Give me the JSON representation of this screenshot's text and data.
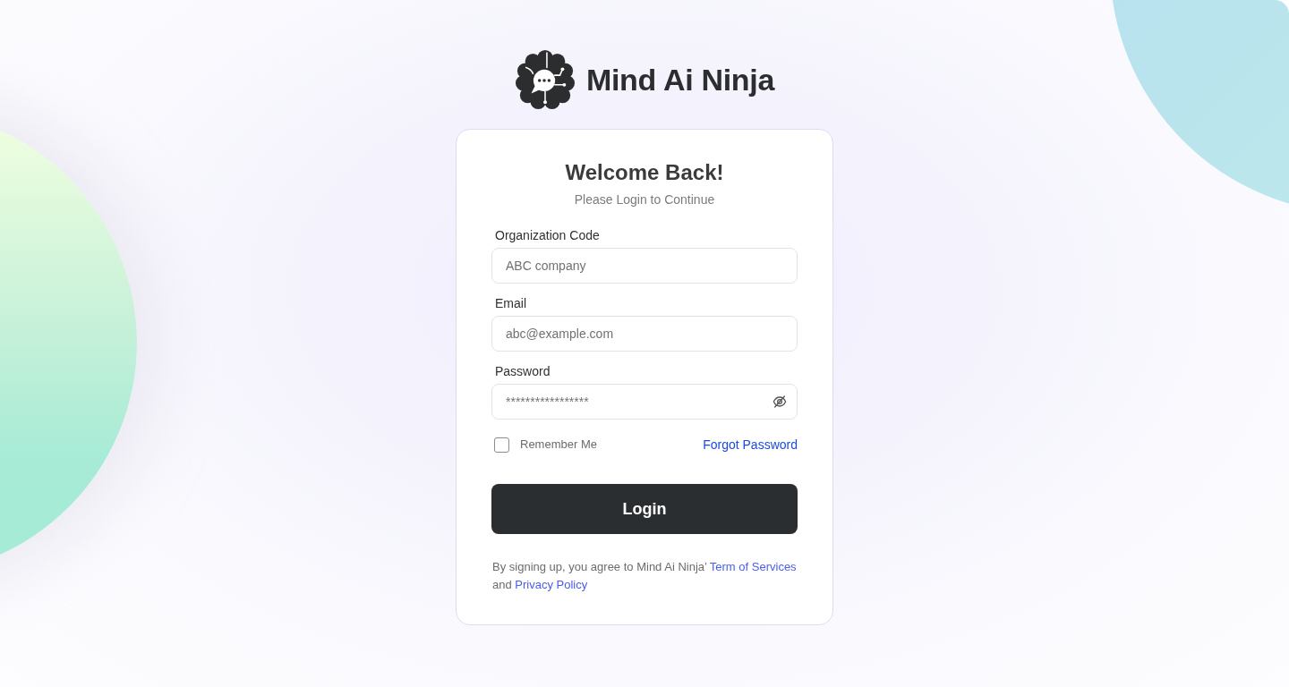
{
  "brand": {
    "name": "Mind Ai Ninja"
  },
  "card": {
    "title": "Welcome Back!",
    "subtitle": "Please Login to Continue"
  },
  "fields": [
    {
      "kind": "text",
      "label": "Organization Code",
      "placeholder": "ABC company"
    },
    {
      "kind": "text",
      "label": "Email",
      "placeholder": "abc@example.com"
    },
    {
      "kind": "password",
      "label": "Password",
      "placeholder": "*****************"
    }
  ],
  "remember_me": {
    "label": "Remember Me",
    "checked": false
  },
  "forgot_password": {
    "label": "Forgot Password"
  },
  "login_button": {
    "label": "Login"
  },
  "terms": [
    {
      "kind": "text",
      "text": "By signing up, you agree to Mind Ai Ninja’ "
    },
    {
      "kind": "link",
      "text": "Term of Services"
    },
    {
      "kind": "text",
      "text": " and "
    },
    {
      "kind": "link",
      "text": "Privacy Policy"
    }
  ]
}
